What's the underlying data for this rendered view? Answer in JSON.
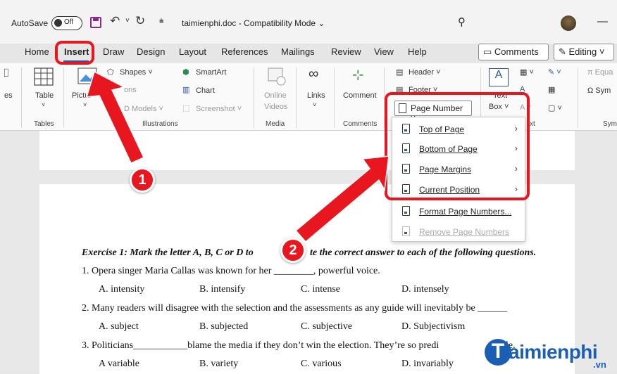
{
  "titlebar": {
    "autosave_label": "AutoSave",
    "autosave_state": "Off",
    "doc_title": "taimienphi.doc  -  Compatibility Mode ⌄"
  },
  "tabs": [
    "Home",
    "Insert",
    "Draw",
    "Design",
    "Layout",
    "References",
    "Mailings",
    "Review",
    "View",
    "Help"
  ],
  "active_tab": "Insert",
  "header_buttons": {
    "comments": "Comments",
    "editing": "Editing ˅"
  },
  "ribbon": {
    "pages_partial": "es",
    "table": "Table",
    "tables_group": "Tables",
    "pictures": "Pictur",
    "shapes": "Shapes ˅",
    "icons": "ons",
    "models_3d": "D Models  ˅",
    "smartart": "SmartArt",
    "chart": "Chart",
    "screenshot": "Screenshot ˅",
    "illustrations_group": "Illustrations",
    "online_videos_1": "Online",
    "online_videos_2": "Videos",
    "media_group": "Media",
    "links": "Links",
    "comment": "Comment",
    "comments_group": "Comments",
    "header": "Header ˅",
    "footer": "Footer ˅",
    "text_box_1": "Text",
    "text_box_2": "Box ˅",
    "text_group_partial": "xt",
    "equation_partial": "π Equa",
    "symbol_partial": "Ω Sym",
    "symbols_group_partial": "Sym"
  },
  "page_number": {
    "button_label": "Page Number ˅",
    "menu": [
      {
        "label": "Top of Page",
        "submenu": true,
        "enabled": true
      },
      {
        "label": "Bottom of Page",
        "submenu": true,
        "enabled": true
      },
      {
        "label": "Page Margins",
        "submenu": true,
        "enabled": true
      },
      {
        "label": "Current Position",
        "submenu": true,
        "enabled": true
      },
      {
        "label": "Format Page Numbers...",
        "submenu": false,
        "enabled": true
      },
      {
        "label": "Remove Page Numbers",
        "submenu": false,
        "enabled": false
      }
    ]
  },
  "document": {
    "exercise_title_a": "Exercise 1: Mark the letter A, B, C or D to",
    "exercise_title_b": "te the correct answer to each of the following questions.",
    "q1": "1.   Opera singer Maria Callas was known for her ________, powerful voice.",
    "q1_options": [
      "A. intensity",
      "B. intensify",
      "C. intense",
      "D. intensely"
    ],
    "q2": "2. Many readers will disagree with the selection and the assessments as any guide will inevitably be ______",
    "q2_options": [
      "A. subject",
      "B. subjected",
      "C. subjective",
      "D. Subjectivism"
    ],
    "q3_a": "3. Politicians___________blame the media if they don’t win the election. They’re so predi",
    "q3_b": "le.",
    "q3_options": [
      "A variable",
      "B. variety",
      "C. various",
      "D. invariably"
    ]
  },
  "annotations": {
    "step1": "1",
    "step2": "2"
  },
  "watermark": {
    "logo_letter": "T",
    "brand": "aimienphi",
    "tld": ".vn"
  },
  "colors": {
    "highlight_red": "#e8161e",
    "word_blue": "#2b579a",
    "watermark_blue": "#1a5fb4"
  }
}
